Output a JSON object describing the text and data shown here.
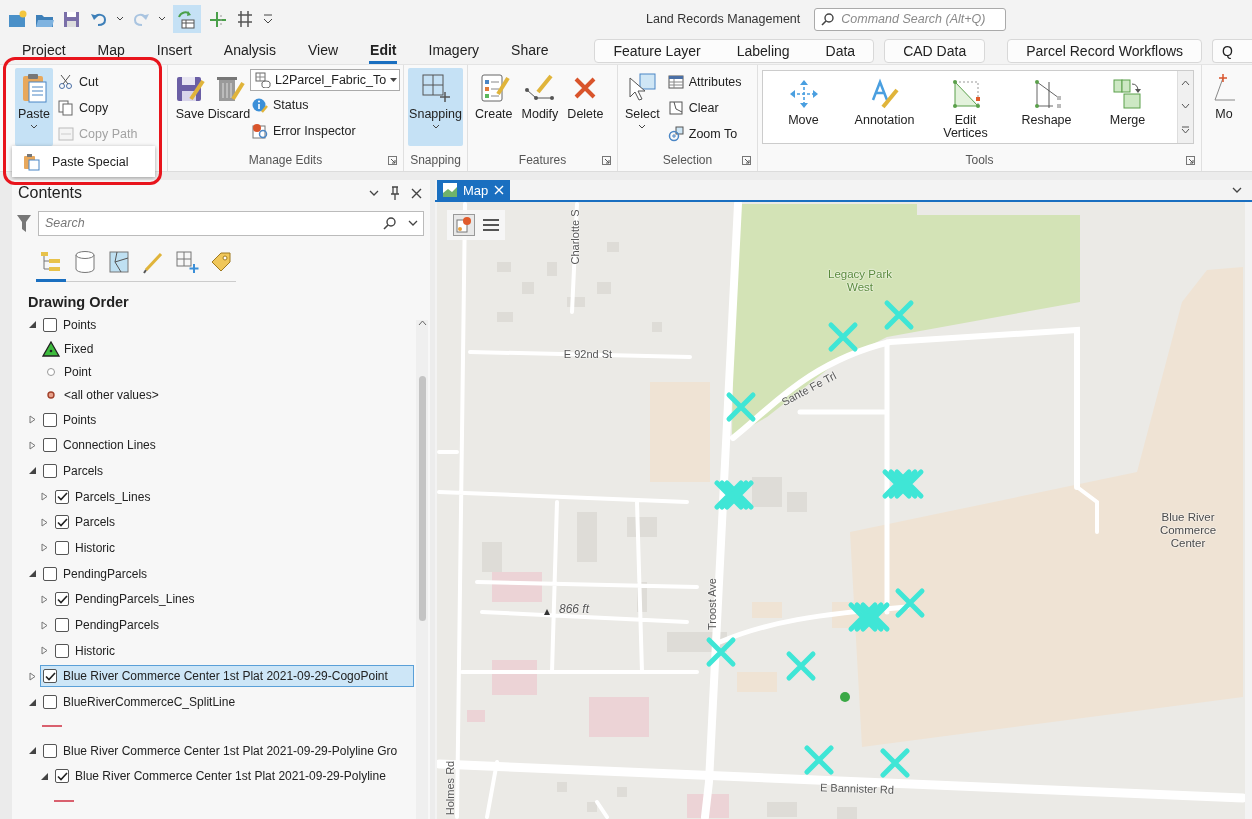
{
  "title_bar": {
    "title": "Land Records Management",
    "command_search": {
      "placeholder": "Command Search (Alt+Q)"
    }
  },
  "ribbon_tabs": [
    {
      "label": "Project",
      "selected": false
    },
    {
      "label": "Map",
      "selected": false
    },
    {
      "label": "Insert",
      "selected": false
    },
    {
      "label": "Analysis",
      "selected": false
    },
    {
      "label": "View",
      "selected": false
    },
    {
      "label": "Edit",
      "selected": true
    },
    {
      "label": "Imagery",
      "selected": false
    },
    {
      "label": "Share",
      "selected": false
    }
  ],
  "contextual_tab_groups": [
    {
      "tabs": [
        "Feature Layer",
        "Labeling",
        "Data"
      ]
    },
    {
      "tabs": [
        "CAD Data"
      ]
    },
    {
      "tabs": [
        "Parcel Record Workflows"
      ]
    },
    {
      "tabs": [
        "Q"
      ]
    }
  ],
  "ribbon": {
    "clipboard": {
      "highlighted": true,
      "paste": {
        "label": "Paste",
        "selected": true
      },
      "commands": [
        {
          "kind": "cut",
          "label": "Cut",
          "disabled": false
        },
        {
          "kind": "copy",
          "label": "Copy",
          "disabled": false
        },
        {
          "kind": "copy-path",
          "label": "Copy Path",
          "disabled": true
        }
      ],
      "paste_menu": [
        {
          "label": "Paste Special"
        }
      ]
    },
    "manage_edits": {
      "label": "Manage Edits",
      "buttons": [
        {
          "kind": "save",
          "label": "Save"
        },
        {
          "kind": "discard",
          "label": "Discard"
        }
      ],
      "fabric_dropdown": {
        "value": "L2Parcel_Fabric_To"
      },
      "commands": [
        {
          "kind": "status",
          "label": "Status"
        },
        {
          "kind": "error-inspector",
          "label": "Error Inspector"
        }
      ]
    },
    "snapping": {
      "label": "Snapping",
      "button": {
        "label": "Snapping",
        "selected": true
      }
    },
    "features": {
      "label": "Features",
      "buttons": [
        {
          "kind": "create",
          "label": "Create"
        },
        {
          "kind": "modify",
          "label": "Modify"
        },
        {
          "kind": "delete",
          "label": "Delete"
        }
      ]
    },
    "selection": {
      "label": "Selection",
      "select": {
        "label": "Select"
      },
      "commands": [
        {
          "kind": "attributes",
          "label": "Attributes"
        },
        {
          "kind": "clear",
          "label": "Clear"
        },
        {
          "kind": "zoom-to",
          "label": "Zoom To"
        }
      ]
    },
    "tools": {
      "label": "Tools",
      "gallery": [
        {
          "kind": "move",
          "label": "Move"
        },
        {
          "kind": "annotation",
          "label": "Annotation"
        },
        {
          "kind": "edit-vertices",
          "label": "Edit Vertices"
        },
        {
          "kind": "reshape",
          "label": "Reshape"
        },
        {
          "kind": "merge",
          "label": "Merge"
        }
      ]
    },
    "next_group": {
      "label": "Mo"
    }
  },
  "contents": {
    "title": "Contents",
    "search": {
      "placeholder": "Search"
    },
    "view_tabs": [
      {
        "kind": "drawing-order",
        "selected": true
      },
      {
        "kind": "source",
        "selected": false
      },
      {
        "kind": "selection",
        "selected": false
      },
      {
        "kind": "editing",
        "selected": false
      },
      {
        "kind": "snapping",
        "selected": false
      },
      {
        "kind": "labeling",
        "selected": false
      }
    ],
    "heading": "Drawing Order",
    "layers": [
      {
        "kind": "layer",
        "label": "Points",
        "checked": false,
        "expanded": true,
        "selected": false,
        "children": [
          {
            "kind": "triangle",
            "label": "Fixed"
          },
          {
            "kind": "circle",
            "label": "Point"
          },
          {
            "kind": "dot",
            "label": "<all other values>"
          }
        ]
      },
      {
        "kind": "layer",
        "label": "Points",
        "checked": false,
        "expanded": false,
        "selected": false
      },
      {
        "kind": "layer",
        "label": "Connection Lines",
        "checked": false,
        "expanded": false,
        "selected": false
      },
      {
        "kind": "layer",
        "label": "Parcels",
        "checked": false,
        "expanded": true,
        "selected": false,
        "children": [
          {
            "kind": "layer",
            "label": "Parcels_Lines",
            "checked": true,
            "expanded": false,
            "selected": false
          },
          {
            "kind": "layer",
            "label": "Parcels",
            "checked": true,
            "expanded": false,
            "selected": false
          },
          {
            "kind": "layer",
            "label": "Historic",
            "checked": false,
            "expanded": false,
            "selected": false
          }
        ]
      },
      {
        "kind": "layer",
        "label": "PendingParcels",
        "checked": false,
        "expanded": true,
        "selected": false,
        "children": [
          {
            "kind": "layer",
            "label": "PendingParcels_Lines",
            "checked": true,
            "expanded": false,
            "selected": false
          },
          {
            "kind": "layer",
            "label": "PendingParcels",
            "checked": false,
            "expanded": false,
            "selected": false
          },
          {
            "kind": "layer",
            "label": "Historic",
            "checked": false,
            "expanded": false,
            "selected": false
          }
        ]
      },
      {
        "kind": "layer",
        "label": "Blue River Commerce Center 1st Plat 2021-09-29-CogoPoint",
        "checked": true,
        "expanded": false,
        "selected": true
      },
      {
        "kind": "layer",
        "label": "BlueRiverCommerceC_SplitLine",
        "checked": false,
        "expanded": true,
        "selected": false,
        "children": [
          {
            "kind": "line"
          }
        ]
      },
      {
        "kind": "layer",
        "label": "Blue River Commerce Center 1st Plat 2021-09-29-Polyline Gro",
        "checked": false,
        "expanded": true,
        "selected": false,
        "children": [
          {
            "kind": "layer",
            "label": "Blue River Commerce Center 1st Plat 2021-09-29-Polyline",
            "checked": true,
            "expanded": true,
            "selected": false,
            "children": [
              {
                "kind": "line"
              }
            ]
          }
        ]
      }
    ]
  },
  "map": {
    "tab": {
      "label": "Map",
      "selected": true
    },
    "labels": [
      {
        "kind": "street",
        "text": "Charlotte S"
      },
      {
        "kind": "street",
        "text": "E 92nd St"
      },
      {
        "kind": "park",
        "text": "Legacy Park West"
      },
      {
        "kind": "street",
        "text": "Sante Fe Trl"
      },
      {
        "kind": "place",
        "text": "Blue River Commerce Center"
      },
      {
        "kind": "elevation",
        "text": "866 ft"
      },
      {
        "kind": "street",
        "text": "Troost Ave"
      },
      {
        "kind": "street",
        "text": "E Bannister Rd"
      },
      {
        "kind": "street",
        "text": "Holmes Rd"
      }
    ]
  }
}
